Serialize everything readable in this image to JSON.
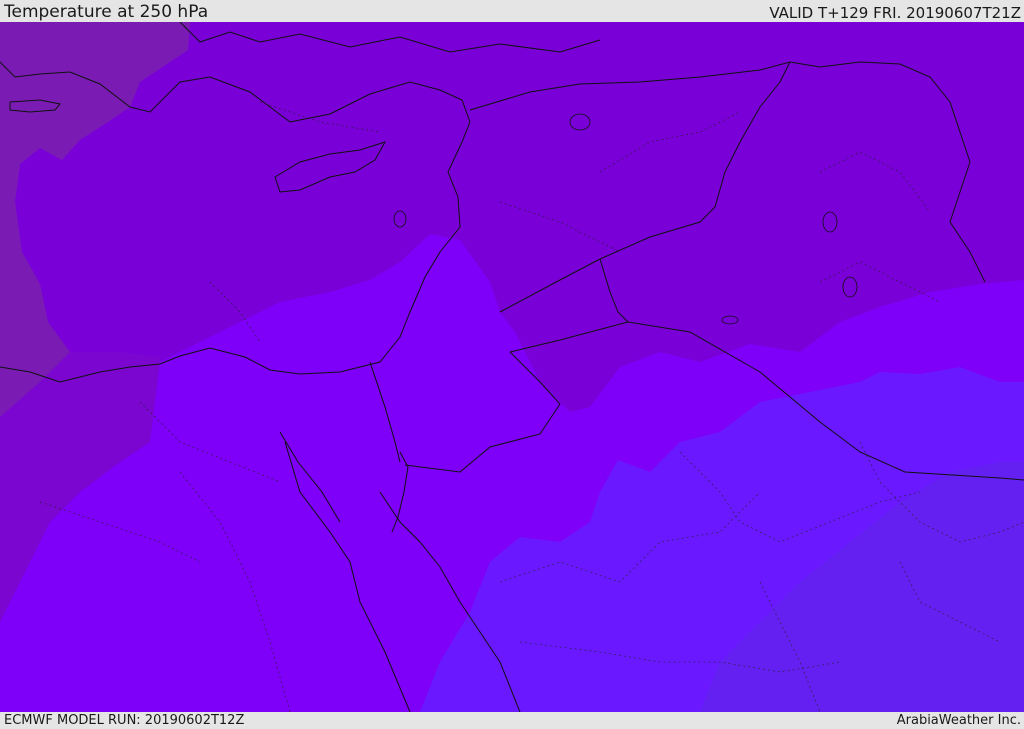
{
  "header": {
    "title": "Temperature at 250 hPa",
    "valid_time": "VALID T+129 FRI. 20190607T21Z"
  },
  "footer": {
    "model_run": "ECMWF MODEL RUN: 20190602T12Z",
    "credit": "ArabiaWeather Inc."
  },
  "map": {
    "shading_colors": {
      "warmest_west": "#7a1cb4",
      "warm": "#7a00d8",
      "mid": "#7f00f8",
      "cool": "#6a18ff",
      "coldest_east": "#6420f0"
    }
  }
}
